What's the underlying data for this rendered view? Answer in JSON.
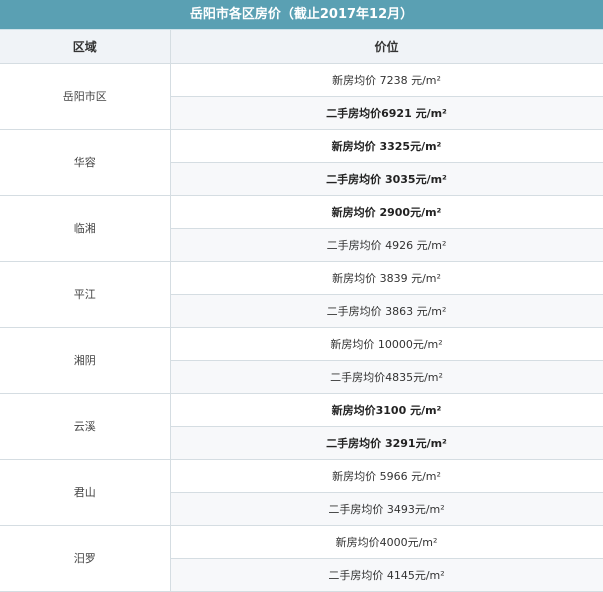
{
  "title": "岳阳市各区房价（截止2017年12月）",
  "headers": {
    "region": "区域",
    "price": "价位"
  },
  "rows": [
    {
      "region": "岳阳市区",
      "prices": [
        {
          "text": "新房均价 7238 元/m²",
          "bold": false
        },
        {
          "text": "二手房均价6921 元/m²",
          "bold": true
        }
      ]
    },
    {
      "region": "华容",
      "prices": [
        {
          "text": "新房均价 3325元/m²",
          "bold": true
        },
        {
          "text": "二手房均价 3035元/m²",
          "bold": true
        }
      ]
    },
    {
      "region": "临湘",
      "prices": [
        {
          "text": "新房均价 2900元/m²",
          "bold": true
        },
        {
          "text": "二手房均价 4926 元/m²",
          "bold": false
        }
      ]
    },
    {
      "region": "平江",
      "prices": [
        {
          "text": "新房均价 3839 元/m²",
          "bold": false
        },
        {
          "text": "二手房均价 3863 元/m²",
          "bold": false
        }
      ]
    },
    {
      "region": "湘阴",
      "prices": [
        {
          "text": "新房均价 10000元/m²",
          "bold": false
        },
        {
          "text": "二手房均价4835元/m²",
          "bold": false
        }
      ]
    },
    {
      "region": "云溪",
      "prices": [
        {
          "text": "新房均价3100 元/m²",
          "bold": true
        },
        {
          "text": "二手房均价 3291元/m²",
          "bold": true
        }
      ]
    },
    {
      "region": "君山",
      "prices": [
        {
          "text": "新房均价 5966 元/m²",
          "bold": false
        },
        {
          "text": "二手房均价 3493元/m²",
          "bold": false
        }
      ]
    },
    {
      "region": "汨罗",
      "prices": [
        {
          "text": "新房均价4000元/m²",
          "bold": false
        },
        {
          "text": "二手房均价 4145元/m²",
          "bold": false
        }
      ]
    }
  ]
}
